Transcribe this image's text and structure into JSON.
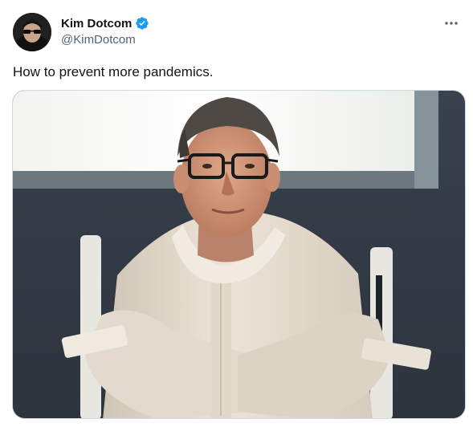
{
  "author": {
    "display_name": "Kim Dotcom",
    "handle": "@KimDotcom",
    "verified": true
  },
  "tweet": {
    "text": "How to prevent more pandemics."
  },
  "icons": {
    "verified": "verified-badge-icon",
    "more": "more-options-icon"
  },
  "colors": {
    "verified": "#1d9bf0",
    "secondary_text": "#536471",
    "border": "#cfd9de"
  }
}
